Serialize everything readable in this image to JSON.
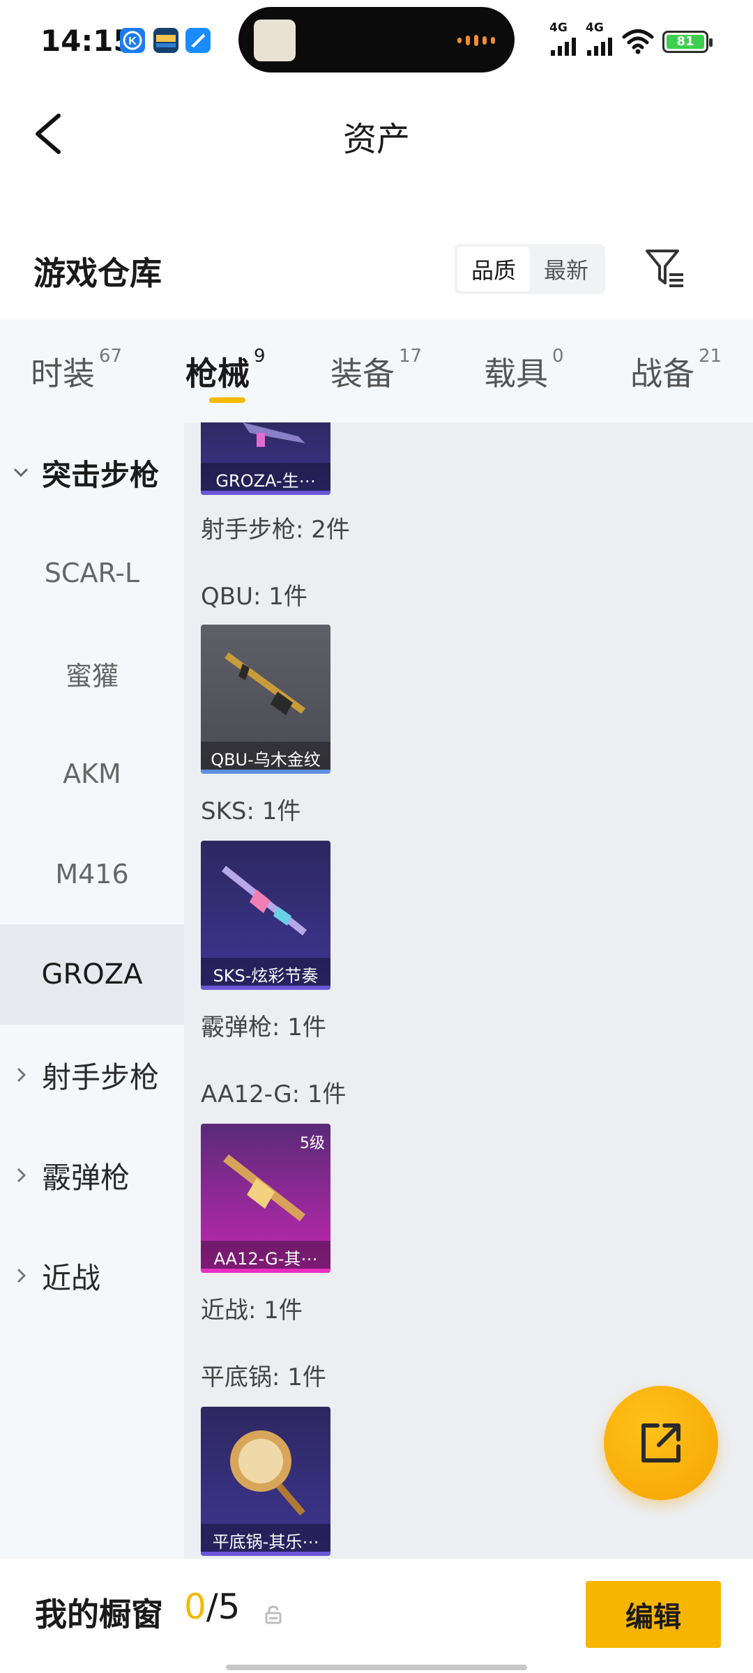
{
  "status_bar": {
    "time": "14:15",
    "network1": "4G",
    "network2": "4G",
    "battery": "81"
  },
  "nav": {
    "title": "资产"
  },
  "warehouse": {
    "title": "游戏仓库",
    "sort_options": [
      "品质",
      "最新"
    ],
    "selected_sort": "品质"
  },
  "tabs": [
    {
      "label": "时装",
      "count": "67"
    },
    {
      "label": "枪械",
      "count": "9"
    },
    {
      "label": "装备",
      "count": "17"
    },
    {
      "label": "载具",
      "count": "0"
    },
    {
      "label": "战备",
      "count": "21"
    }
  ],
  "active_tab": "枪械",
  "sidebar": {
    "groups": [
      {
        "label": "突击步枪",
        "expanded": true,
        "children": [
          "SCAR-L",
          "蜜獾",
          "AKM",
          "M416",
          "GROZA"
        ]
      },
      {
        "label": "射手步枪",
        "expanded": false
      },
      {
        "label": "霰弹枪",
        "expanded": false
      },
      {
        "label": "近战",
        "expanded": false
      }
    ],
    "selected": "GROZA"
  },
  "content": {
    "groza_card": "GROZA-生⋯",
    "marksman_header": "射手步枪: 2件",
    "qbu_header": "QBU: 1件",
    "qbu_card": "QBU-乌木金纹",
    "sks_header": "SKS: 1件",
    "sks_card": "SKS-炫彩节奏",
    "shotgun_header": "霰弹枪: 1件",
    "aa12_header": "AA12-G: 1件",
    "aa12_card": "AA12-G-其⋯",
    "aa12_level": "5级",
    "melee_header": "近战: 1件",
    "pan_header": "平底锅: 1件",
    "pan_card": "平底锅-其乐⋯"
  },
  "bottom_bar": {
    "label": "我的橱窗",
    "current": "0",
    "total": "/5",
    "edit_label": "编辑"
  },
  "icons": {
    "back": "back-arrow-icon",
    "filter": "filter-icon",
    "share": "share-external-icon",
    "lock": "lock-icon"
  },
  "colors": {
    "accent": "#f5b800",
    "tab_bg": "#f5f8fb",
    "content_bg": "#eceef1",
    "rare_purple": "#3b2f7a",
    "legendary_pink": "#d21fa8"
  }
}
